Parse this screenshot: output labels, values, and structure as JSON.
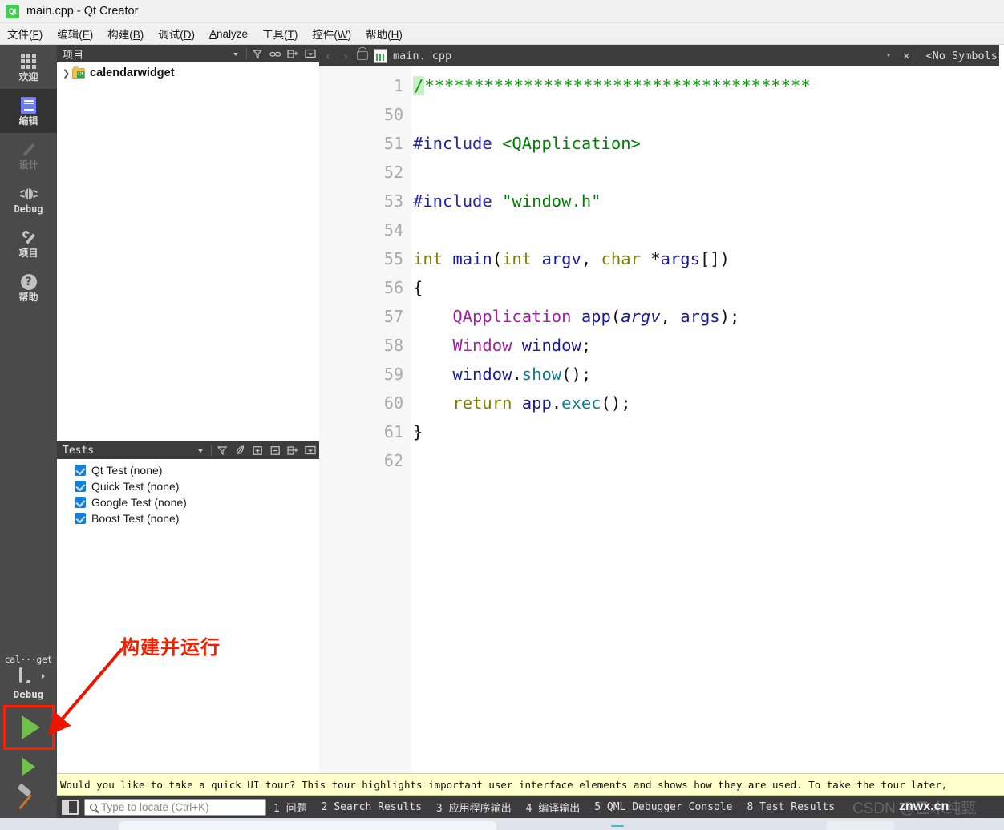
{
  "window": {
    "title": "main.cpp - Qt Creator",
    "logo_text": "Qt",
    "logo_name": "qt-creator-logo-icon"
  },
  "menubar": {
    "items": [
      {
        "label": "文件(F)",
        "pre": "文件(",
        "mnemonic": "F",
        "post": ")"
      },
      {
        "label": "编辑(E)",
        "pre": "编辑(",
        "mnemonic": "E",
        "post": ")"
      },
      {
        "label": "构建(B)",
        "pre": "构建(",
        "mnemonic": "B",
        "post": ")"
      },
      {
        "label": "调试(D)",
        "pre": "调试(",
        "mnemonic": "D",
        "post": ")"
      },
      {
        "label": "Analyze",
        "pre": "",
        "mnemonic": "A",
        "post": "nalyze"
      },
      {
        "label": "工具(T)",
        "pre": "工具(",
        "mnemonic": "T",
        "post": ")"
      },
      {
        "label": "控件(W)",
        "pre": "控件(",
        "mnemonic": "W",
        "post": ")"
      },
      {
        "label": "帮助(H)",
        "pre": "帮助(",
        "mnemonic": "H",
        "post": ")"
      }
    ]
  },
  "modebar": {
    "modes": [
      {
        "label": "欢迎",
        "icon": "grid-icon",
        "active": false,
        "disabled": false
      },
      {
        "label": "编辑",
        "icon": "document-edit-icon",
        "active": true,
        "disabled": false
      },
      {
        "label": "设计",
        "icon": "pencil-icon",
        "active": false,
        "disabled": true
      },
      {
        "label": "Debug",
        "icon": "bug-icon",
        "active": false,
        "disabled": false
      },
      {
        "label": "项目",
        "icon": "wrench-icon",
        "active": false,
        "disabled": false
      },
      {
        "label": "帮助",
        "icon": "question-mark-icon",
        "active": false,
        "disabled": false
      }
    ],
    "kit": {
      "project_name": "cal···get",
      "build_config": "Debug",
      "target_icon": "desktop-monitor-icon"
    },
    "run_button": {
      "name": "run-button",
      "icon": "play-triangle-icon"
    },
    "debug_button": {
      "name": "start-debugging-button",
      "icon": "play-with-bug-icon"
    },
    "build_button": {
      "name": "build-project-button",
      "icon": "hammer-icon"
    }
  },
  "project_panel": {
    "title": "项目",
    "toolbar": [
      {
        "name": "filter-button",
        "glyph": "filter-icon"
      },
      {
        "name": "link-with-editor-button",
        "glyph": "link-icon"
      },
      {
        "name": "expand-all-button",
        "glyph": "expand-icon"
      },
      {
        "name": "panel-menu-button",
        "glyph": "panel-menu-icon"
      }
    ],
    "tree": [
      {
        "name": "calendarwidget",
        "expanded": false,
        "icon": "qt-project-folder-icon"
      }
    ]
  },
  "tests_panel": {
    "title": "Tests",
    "toolbar": [
      {
        "name": "filter-button",
        "glyph": "filter-icon"
      },
      {
        "name": "run-selected-tests-button",
        "glyph": "leaf-icon"
      },
      {
        "name": "expand-all-button",
        "glyph": "plus-box-icon"
      },
      {
        "name": "collapse-all-button",
        "glyph": "minus-box-icon"
      },
      {
        "name": "new-test-button",
        "glyph": "new-split-icon"
      },
      {
        "name": "panel-menu-button",
        "glyph": "panel-menu-icon"
      }
    ],
    "items": [
      {
        "label": "Qt Test (none)",
        "checked": true
      },
      {
        "label": "Quick Test (none)",
        "checked": true
      },
      {
        "label": "Google Test (none)",
        "checked": true
      },
      {
        "label": "Boost Test (none)",
        "checked": true
      }
    ]
  },
  "editor": {
    "toolbar": {
      "back_label": "‹",
      "forward_label": "›",
      "lock_name": "unlocked-icon",
      "filename": "main. cpp",
      "dropdown_label": "▾",
      "close_label": "✕",
      "symbols_label": "<No Symbols>"
    },
    "lines": [
      {
        "num": "1",
        "fold": "▸",
        "tokens": [
          {
            "t": "/",
            "c": "first-comment c-green"
          },
          {
            "t": "***************************************",
            "c": "c-green"
          }
        ]
      },
      {
        "num": "50",
        "fold": "",
        "tokens": []
      },
      {
        "num": "51",
        "fold": "▾",
        "tokens": [
          {
            "t": "#include ",
            "c": "c-preproc"
          },
          {
            "t": "<QApplication>",
            "c": "c-str"
          }
        ]
      },
      {
        "num": "52",
        "fold": "",
        "tokens": []
      },
      {
        "num": "53",
        "fold": "",
        "tokens": [
          {
            "t": "#include ",
            "c": "c-preproc"
          },
          {
            "t": "\"window.h\"",
            "c": "c-str"
          }
        ]
      },
      {
        "num": "54",
        "fold": "",
        "tokens": []
      },
      {
        "num": "55",
        "fold": "▾",
        "tokens": [
          {
            "t": "int",
            "c": "c-type"
          },
          {
            "t": " ",
            "c": "c-plain"
          },
          {
            "t": "main",
            "c": "c-fn"
          },
          {
            "t": "(",
            "c": "c-plain"
          },
          {
            "t": "int",
            "c": "c-type"
          },
          {
            "t": " ",
            "c": "c-plain"
          },
          {
            "t": "argv",
            "c": "c-var"
          },
          {
            "t": ", ",
            "c": "c-plain"
          },
          {
            "t": "char",
            "c": "c-type"
          },
          {
            "t": " *",
            "c": "c-plain"
          },
          {
            "t": "args",
            "c": "c-var"
          },
          {
            "t": "[])",
            "c": "c-plain"
          }
        ]
      },
      {
        "num": "56",
        "fold": "",
        "tokens": [
          {
            "t": "{",
            "c": "c-plain"
          }
        ]
      },
      {
        "num": "57",
        "fold": "",
        "tokens": [
          {
            "t": "    ",
            "c": "c-plain"
          },
          {
            "t": "QApplication",
            "c": "c-cls"
          },
          {
            "t": " ",
            "c": "c-plain"
          },
          {
            "t": "app",
            "c": "c-var"
          },
          {
            "t": "(",
            "c": "c-plain"
          },
          {
            "t": "argv",
            "c": "c-param"
          },
          {
            "t": ", ",
            "c": "c-plain"
          },
          {
            "t": "args",
            "c": "c-var"
          },
          {
            "t": ");",
            "c": "c-plain"
          }
        ]
      },
      {
        "num": "58",
        "fold": "",
        "tokens": [
          {
            "t": "    ",
            "c": "c-plain"
          },
          {
            "t": "Window",
            "c": "c-cls"
          },
          {
            "t": " ",
            "c": "c-plain"
          },
          {
            "t": "window",
            "c": "c-var"
          },
          {
            "t": ";",
            "c": "c-plain"
          }
        ]
      },
      {
        "num": "59",
        "fold": "",
        "tokens": [
          {
            "t": "    ",
            "c": "c-plain"
          },
          {
            "t": "window",
            "c": "c-var"
          },
          {
            "t": ".",
            "c": "c-plain"
          },
          {
            "t": "show",
            "c": "c-member"
          },
          {
            "t": "();",
            "c": "c-plain"
          }
        ]
      },
      {
        "num": "60",
        "fold": "",
        "tokens": [
          {
            "t": "    ",
            "c": "c-plain"
          },
          {
            "t": "return",
            "c": "c-kw"
          },
          {
            "t": " ",
            "c": "c-plain"
          },
          {
            "t": "app",
            "c": "c-var"
          },
          {
            "t": ".",
            "c": "c-plain"
          },
          {
            "t": "exec",
            "c": "c-member"
          },
          {
            "t": "();",
            "c": "c-plain"
          }
        ]
      },
      {
        "num": "61",
        "fold": "",
        "tokens": [
          {
            "t": "}",
            "c": "c-plain"
          }
        ]
      },
      {
        "num": "62",
        "fold": "",
        "tokens": []
      }
    ]
  },
  "annotation": {
    "text": "构建并运行",
    "color": "#ee2200"
  },
  "tour_banner": {
    "text": "Would you like to take a quick UI tour? This tour highlights important user interface elements and shows how they are used. To take the tour later,"
  },
  "statusbar": {
    "toggle_name": "toggle-sidebar-button",
    "locator_placeholder": "Type to locate (Ctrl+K)",
    "locator_value": "",
    "items": [
      {
        "num": "1",
        "label": "问题"
      },
      {
        "num": "2",
        "label": "Search Results"
      },
      {
        "num": "3",
        "label": "应用程序输出"
      },
      {
        "num": "4",
        "label": "编译输出"
      },
      {
        "num": "5",
        "label": "QML Debugger Console"
      },
      {
        "num": "8",
        "label": "Test Results"
      }
    ]
  },
  "watermark": {
    "back_text": "CSDN @乙木纯甄",
    "front_text": "znwx.cn"
  }
}
